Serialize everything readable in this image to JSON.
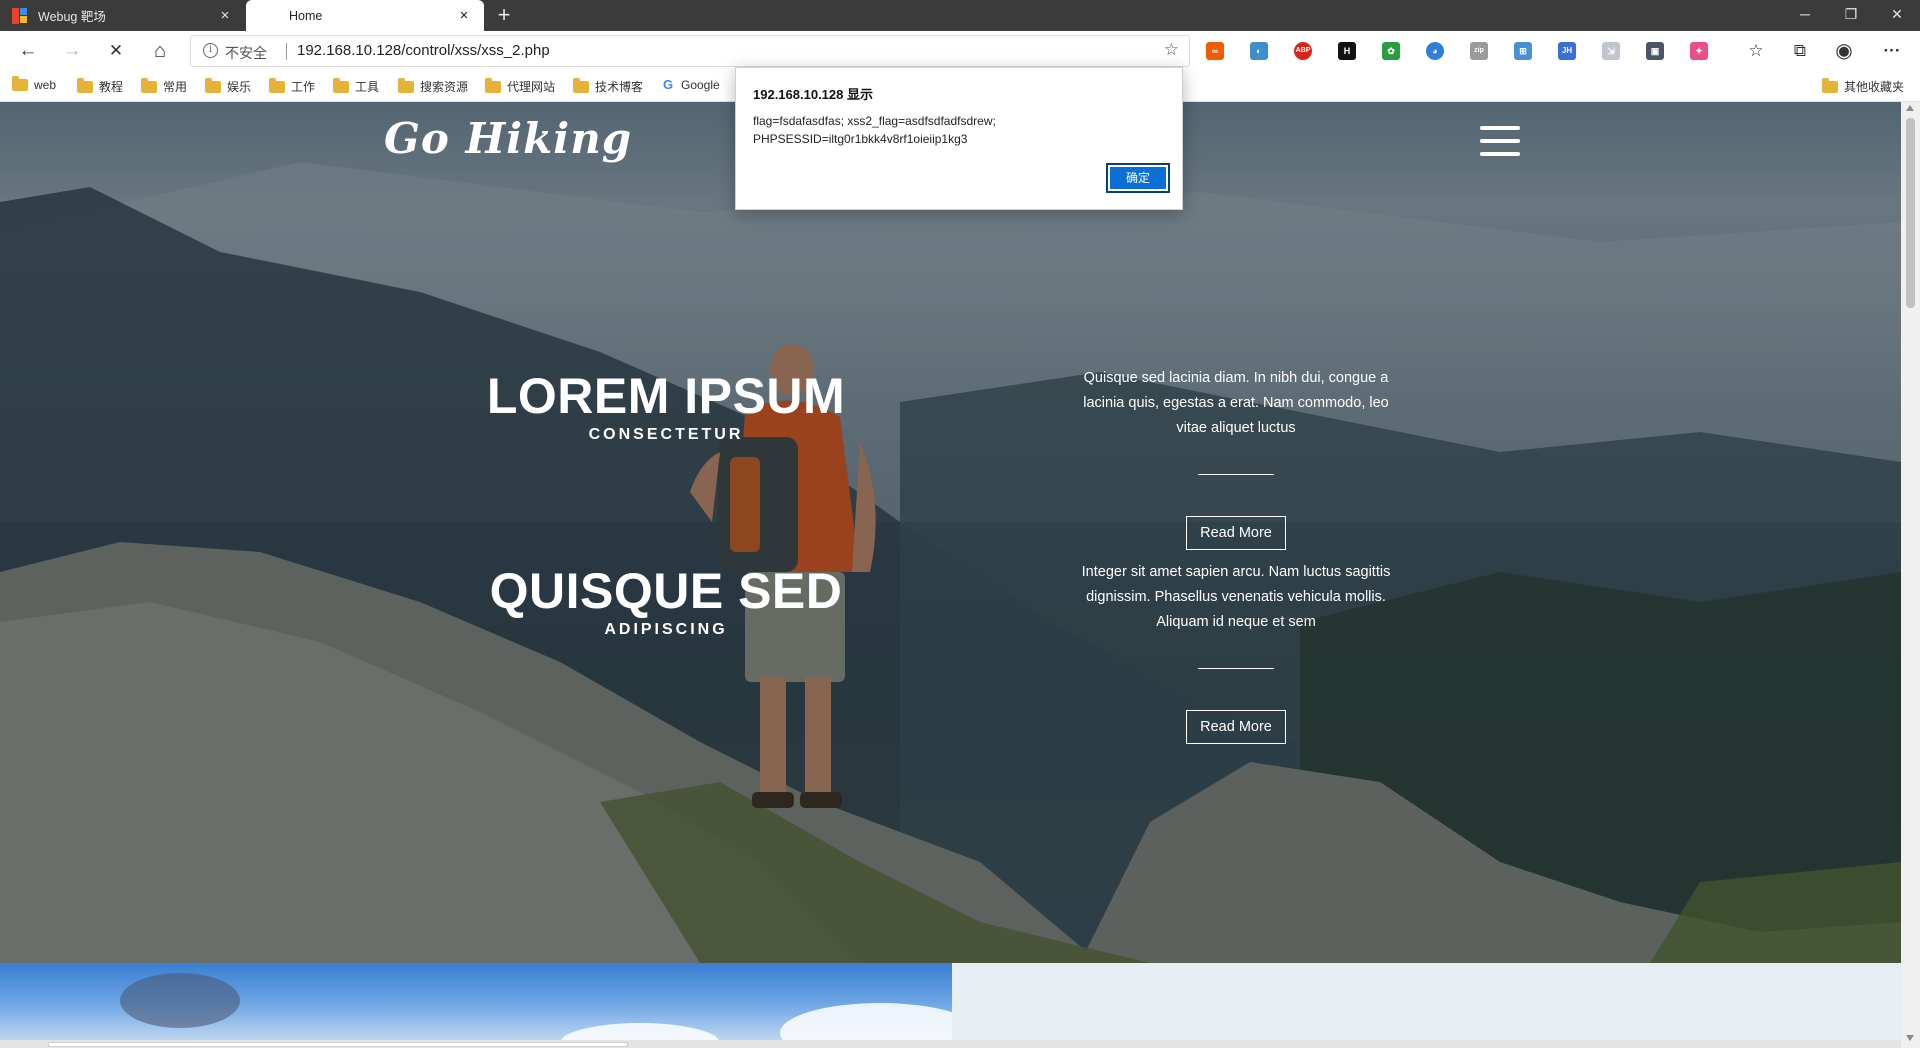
{
  "browser": {
    "tabs": [
      {
        "label": "Webug 靶场",
        "active": false
      },
      {
        "label": "Home",
        "active": true
      }
    ],
    "new_tab": "+",
    "window_controls": {
      "minimize": "─",
      "restore": "❐",
      "close": "✕"
    },
    "nav": {
      "back": "←",
      "forward": "→",
      "stop": "✕",
      "home": "⌂"
    },
    "address": {
      "security_label": "不安全",
      "url": "192.168.10.128/control/xss/xss_2.php",
      "star": "☆"
    },
    "extensions": [
      "∞",
      "◐",
      "ABP",
      "H",
      "✿",
      "◕",
      "zip",
      "⊞",
      "JH",
      "⇲",
      "▣",
      "✦"
    ],
    "toolbar_icons": {
      "favorites": "☆",
      "collections": "⧉",
      "profile": "◉",
      "menu": "···"
    },
    "bookmarks": [
      {
        "label": "web",
        "type": "folder"
      },
      {
        "label": "教程",
        "type": "folder"
      },
      {
        "label": "常用",
        "type": "folder"
      },
      {
        "label": "娱乐",
        "type": "folder"
      },
      {
        "label": "工作",
        "type": "folder"
      },
      {
        "label": "工具",
        "type": "folder"
      },
      {
        "label": "搜索资源",
        "type": "folder"
      },
      {
        "label": "代理网站",
        "type": "folder"
      },
      {
        "label": "技术博客",
        "type": "folder"
      },
      {
        "label": "Google",
        "type": "google"
      }
    ],
    "other_bookmarks": "其他收藏夹"
  },
  "page": {
    "logo": "Go Hiking",
    "slides": [
      {
        "title": "LOREM IPSUM",
        "subtitle": "CONSECTETUR",
        "text": "Quisque sed lacinia diam. In nibh dui, congue a lacinia quis, egestas a erat. Nam commodo, leo vitae aliquet luctus",
        "button": "Read More"
      },
      {
        "title": "QUISQUE SED",
        "subtitle": "ADIPISCING",
        "text": "Integer sit amet sapien arcu. Nam luctus sagittis dignissim. Phasellus venenatis vehicula mollis. Aliquam id neque et sem",
        "button": "Read More"
      }
    ]
  },
  "dialog": {
    "title": "192.168.10.128 显示",
    "message": "flag=fsdafasdfas; xss2_flag=asdfsdfadfsdrew; PHPSESSID=iltg0r1bkk4v8rf1oieiip1kg3",
    "ok": "确定"
  },
  "colors": {
    "accent": "#0b6fd6",
    "tabstrip": "#3b3b3b",
    "folder": "#e6b23a"
  }
}
